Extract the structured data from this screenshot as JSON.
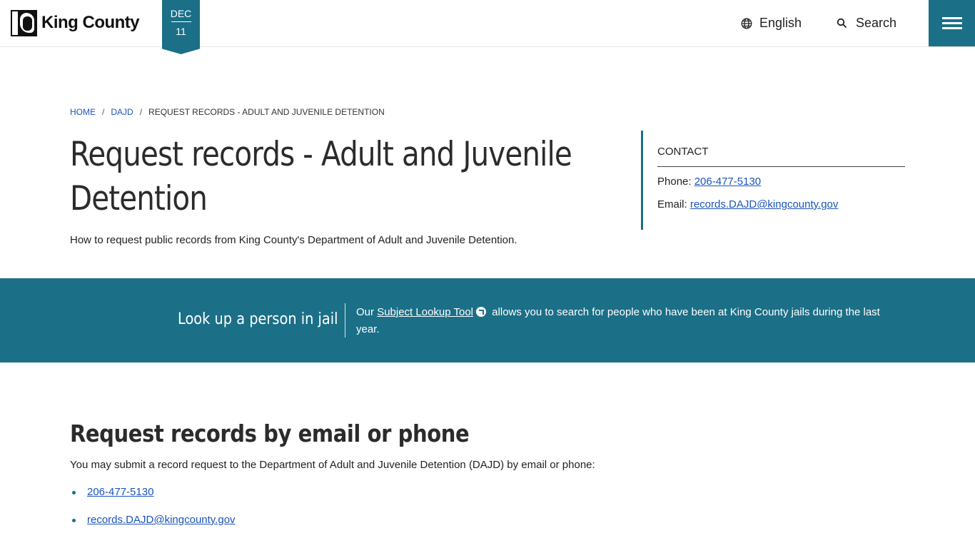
{
  "header": {
    "logo_text": "King County",
    "date_month": "DEC",
    "date_day": "11",
    "language_label": "English",
    "search_label": "Search"
  },
  "breadcrumb": {
    "home": "HOME",
    "section": "DAJD",
    "current": "REQUEST RECORDS - ADULT AND JUVENILE DETENTION",
    "separator": "/"
  },
  "page": {
    "title": "Request records - Adult and Juvenile Detention",
    "subtitle": "How to request public records from King County's Department of Adult and Juvenile Detention."
  },
  "contact": {
    "heading": "CONTACT",
    "phone_label": "Phone: ",
    "phone": "206-477-5130",
    "email_label": "Email: ",
    "email": "records.DAJD@kingcounty.gov"
  },
  "banner": {
    "title": "Look up a person in jail",
    "text_before": "Our ",
    "link": "Subject Lookup Tool",
    "text_after": " allows you to search for people who have been at King County jails during the last year."
  },
  "section": {
    "title": "Request records by email or phone",
    "text": "You may submit a record request to the Department of Adult and Juvenile Detention (DAJD) by email or phone:",
    "items": [
      "206-477-5130",
      "records.DAJD@kingcounty.gov"
    ]
  },
  "colors": {
    "accent": "#1b6f87",
    "link": "#1a55b8"
  },
  "icons": {
    "language": "globe-icon",
    "search": "search-icon",
    "menu": "hamburger-menu-icon",
    "external": "external-link-icon"
  }
}
